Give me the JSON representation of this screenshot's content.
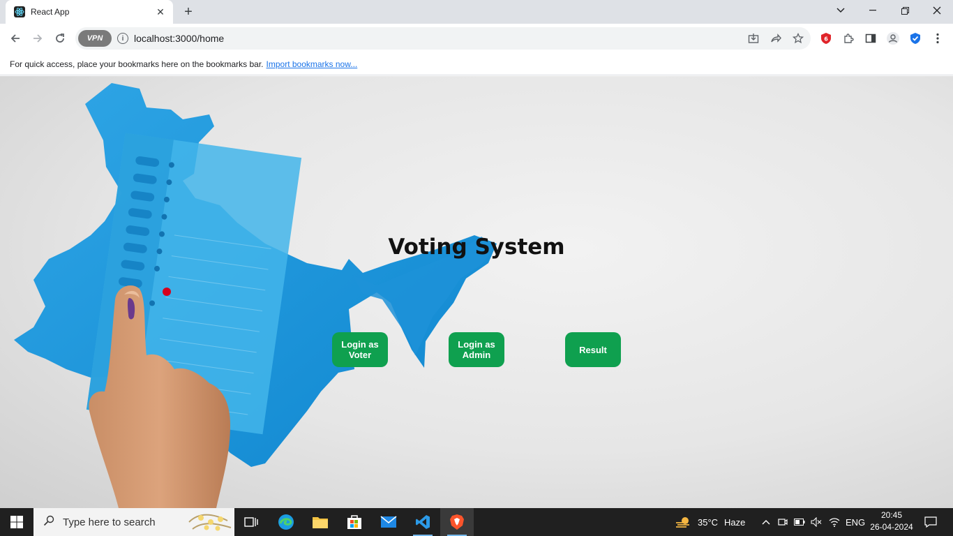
{
  "browser": {
    "tab": {
      "title": "React App",
      "favicon": "react-icon"
    },
    "url": "localhost:3000/home",
    "vpn_label": "VPN",
    "bookmarks_bar": {
      "message": "For quick access, place your bookmarks here on the bookmarks bar.",
      "link": "Import bookmarks now..."
    }
  },
  "page": {
    "title": "Voting System",
    "buttons": {
      "voter": "Login as Voter",
      "admin": "Login as Admin",
      "result": "Result"
    },
    "accent_color": "#0fa04f"
  },
  "taskbar": {
    "search_placeholder": "Type here to search",
    "weather": {
      "temp": "35°C",
      "condition": "Haze"
    },
    "language": "ENG",
    "time": "20:45",
    "date": "26-04-2024",
    "apps": [
      "task-view-icon",
      "edge-icon",
      "file-explorer-icon",
      "store-icon",
      "mail-icon",
      "vscode-icon",
      "brave-icon"
    ]
  }
}
